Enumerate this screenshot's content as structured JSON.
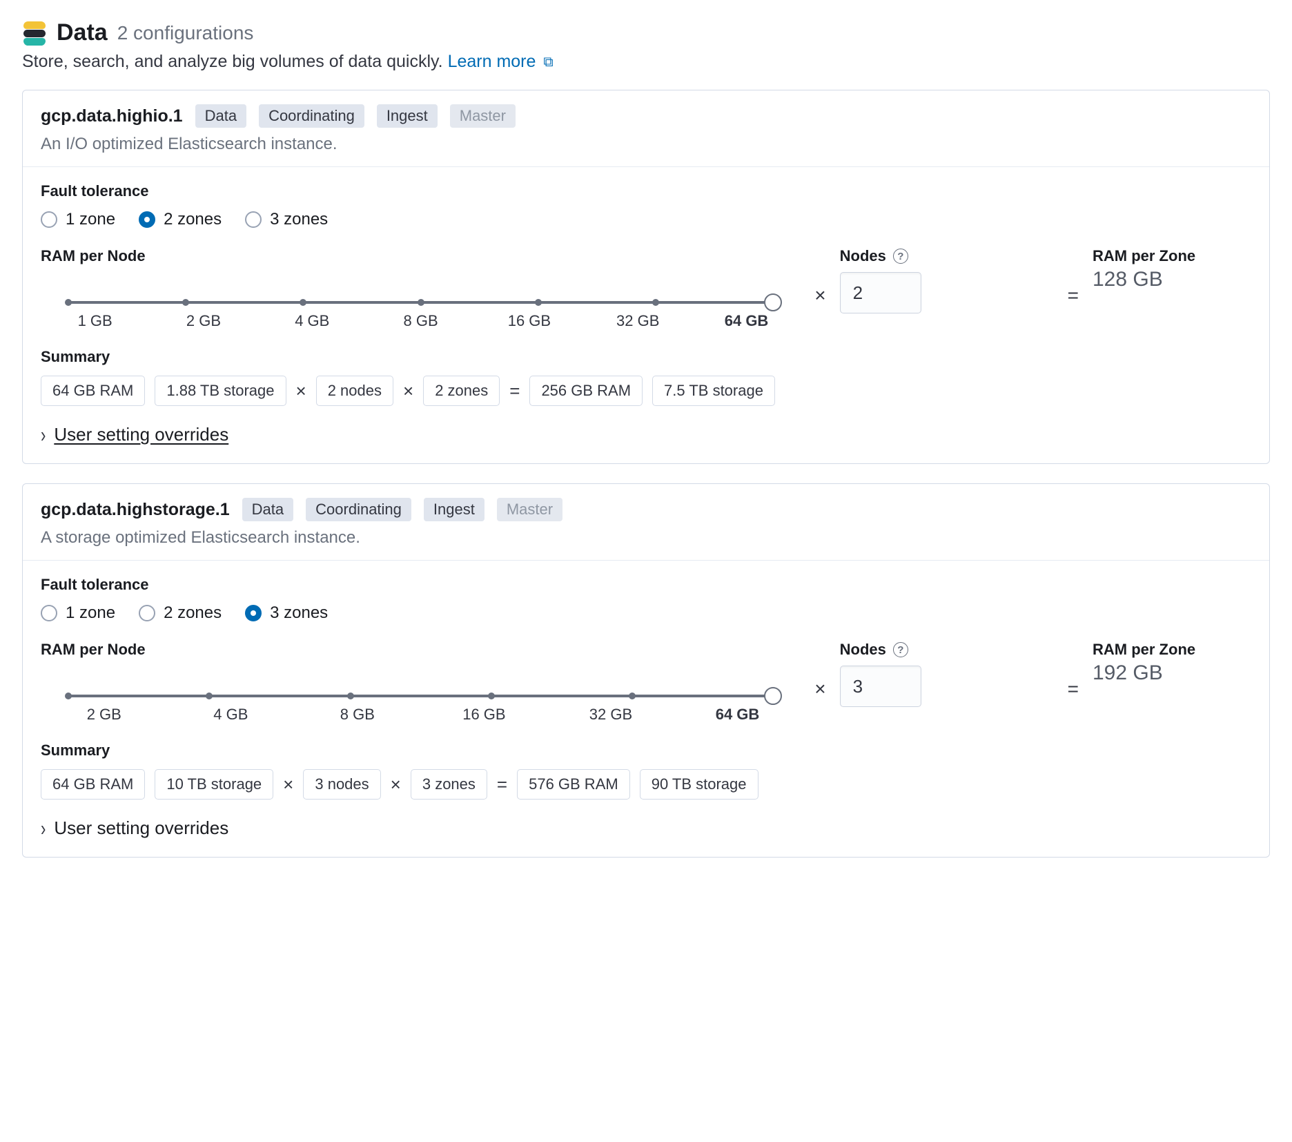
{
  "header": {
    "title": "Data",
    "config_count": "2 configurations",
    "subtitle": "Store, search, and analyze big volumes of data quickly.",
    "learn_more": "Learn more"
  },
  "configs": [
    {
      "title": "gcp.data.highio.1",
      "badges": [
        {
          "label": "Data",
          "disabled": false
        },
        {
          "label": "Coordinating",
          "disabled": false
        },
        {
          "label": "Ingest",
          "disabled": false
        },
        {
          "label": "Master",
          "disabled": true
        }
      ],
      "desc": "An I/O optimized Elasticsearch instance.",
      "fault_label": "Fault tolerance",
      "zones": [
        "1 zone",
        "2 zones",
        "3 zones"
      ],
      "zone_selected_index": 1,
      "ram_label": "RAM per Node",
      "slider_values": [
        "1 GB",
        "2 GB",
        "4 GB",
        "8 GB",
        "16 GB",
        "32 GB",
        "64 GB"
      ],
      "slider_selected_index": 6,
      "nodes_label": "Nodes",
      "nodes_value": "2",
      "ram_per_zone_label": "RAM per Zone",
      "ram_per_zone_value": "128 GB",
      "summary_label": "Summary",
      "summary": {
        "ram_each": "64 GB RAM",
        "storage_each": "1.88 TB storage",
        "nodes": "2 nodes",
        "zones": "2 zones",
        "ram_total": "256 GB RAM",
        "storage_total": "7.5 TB storage"
      },
      "overrides_label": "User setting overrides",
      "overrides_underline": true
    },
    {
      "title": "gcp.data.highstorage.1",
      "badges": [
        {
          "label": "Data",
          "disabled": false
        },
        {
          "label": "Coordinating",
          "disabled": false
        },
        {
          "label": "Ingest",
          "disabled": false
        },
        {
          "label": "Master",
          "disabled": true
        }
      ],
      "desc": "A storage optimized Elasticsearch instance.",
      "fault_label": "Fault tolerance",
      "zones": [
        "1 zone",
        "2 zones",
        "3 zones"
      ],
      "zone_selected_index": 2,
      "ram_label": "RAM per Node",
      "slider_values": [
        "2 GB",
        "4 GB",
        "8 GB",
        "16 GB",
        "32 GB",
        "64 GB"
      ],
      "slider_selected_index": 5,
      "nodes_label": "Nodes",
      "nodes_value": "3",
      "ram_per_zone_label": "RAM per Zone",
      "ram_per_zone_value": "192 GB",
      "summary_label": "Summary",
      "summary": {
        "ram_each": "64 GB RAM",
        "storage_each": "10 TB storage",
        "nodes": "3 nodes",
        "zones": "3 zones",
        "ram_total": "576 GB RAM",
        "storage_total": "90 TB storage"
      },
      "overrides_label": "User setting overrides",
      "overrides_underline": false
    }
  ],
  "symbols": {
    "times": "×",
    "equals": "="
  }
}
